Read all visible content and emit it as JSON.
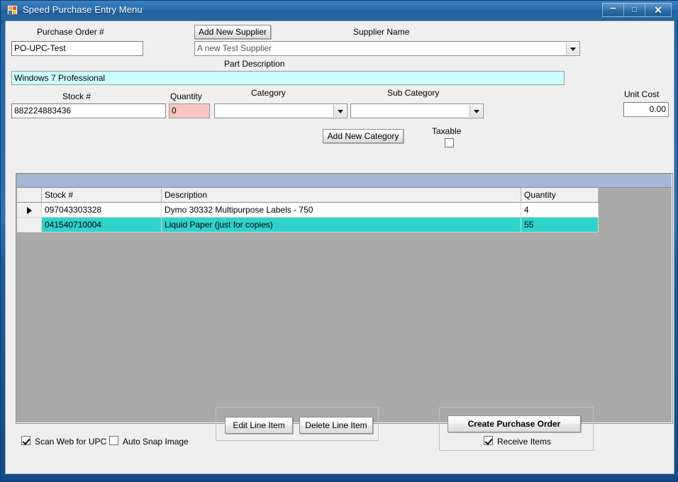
{
  "window": {
    "title": "Speed Purchase Entry Menu",
    "icon": "app-form-icon",
    "minimize_label": "–",
    "maximize_label": "□",
    "close_label": "✕"
  },
  "form": {
    "purchase_order": {
      "label": "Purchase Order #",
      "value": "PO-UPC-Test"
    },
    "add_new_supplier_label": "Add New Supplier",
    "supplier": {
      "label": "Supplier Name",
      "value": "A new Test Supplier"
    },
    "part_description": {
      "label": "Part Description",
      "value": "Windows 7 Professional"
    },
    "stock_number": {
      "label": "Stock #",
      "value": "882224883436"
    },
    "quantity": {
      "label": "Quantity",
      "value": "0"
    },
    "category": {
      "label": "Category",
      "value": ""
    },
    "sub_category": {
      "label": "Sub Category",
      "value": ""
    },
    "unit_cost": {
      "label": "Unit Cost",
      "value": "0.00"
    },
    "add_new_category_label": "Add New Category",
    "taxable": {
      "label": "Taxable",
      "checked": false
    }
  },
  "grid": {
    "columns": [
      "",
      "Stock #",
      "Description",
      "Quantity"
    ],
    "rows": [
      {
        "indicator": "▶",
        "stock": "097043303328",
        "description": "Dymo 30332 Multipurpose Labels - 750",
        "quantity": "4",
        "selected": false
      },
      {
        "indicator": "",
        "stock": "041540710004",
        "description": "Liquid Paper (just for copies)",
        "quantity": "55",
        "selected": true
      }
    ]
  },
  "actions": {
    "edit_line_item_label": "Edit Line Item",
    "delete_line_item_label": "Delete Line Item",
    "create_purchase_order_label": "Create Purchase Order",
    "receive_items": {
      "label": "Receive Items",
      "checked": true
    }
  },
  "options": {
    "scan_web_for_upc": {
      "label": "Scan Web for UPC",
      "checked": true
    },
    "auto_snap_image": {
      "label": "Auto Snap Image",
      "checked": false
    }
  },
  "colors": {
    "title_bar": "#2a6dae",
    "part_description_bg": "#ccffff",
    "quantity_invalid_bg": "#f9c4c4",
    "selected_row_bg": "#2fd3cb",
    "grid_caption_bg": "#a3b8d4",
    "grid_body_bg": "#a9a9a9"
  }
}
